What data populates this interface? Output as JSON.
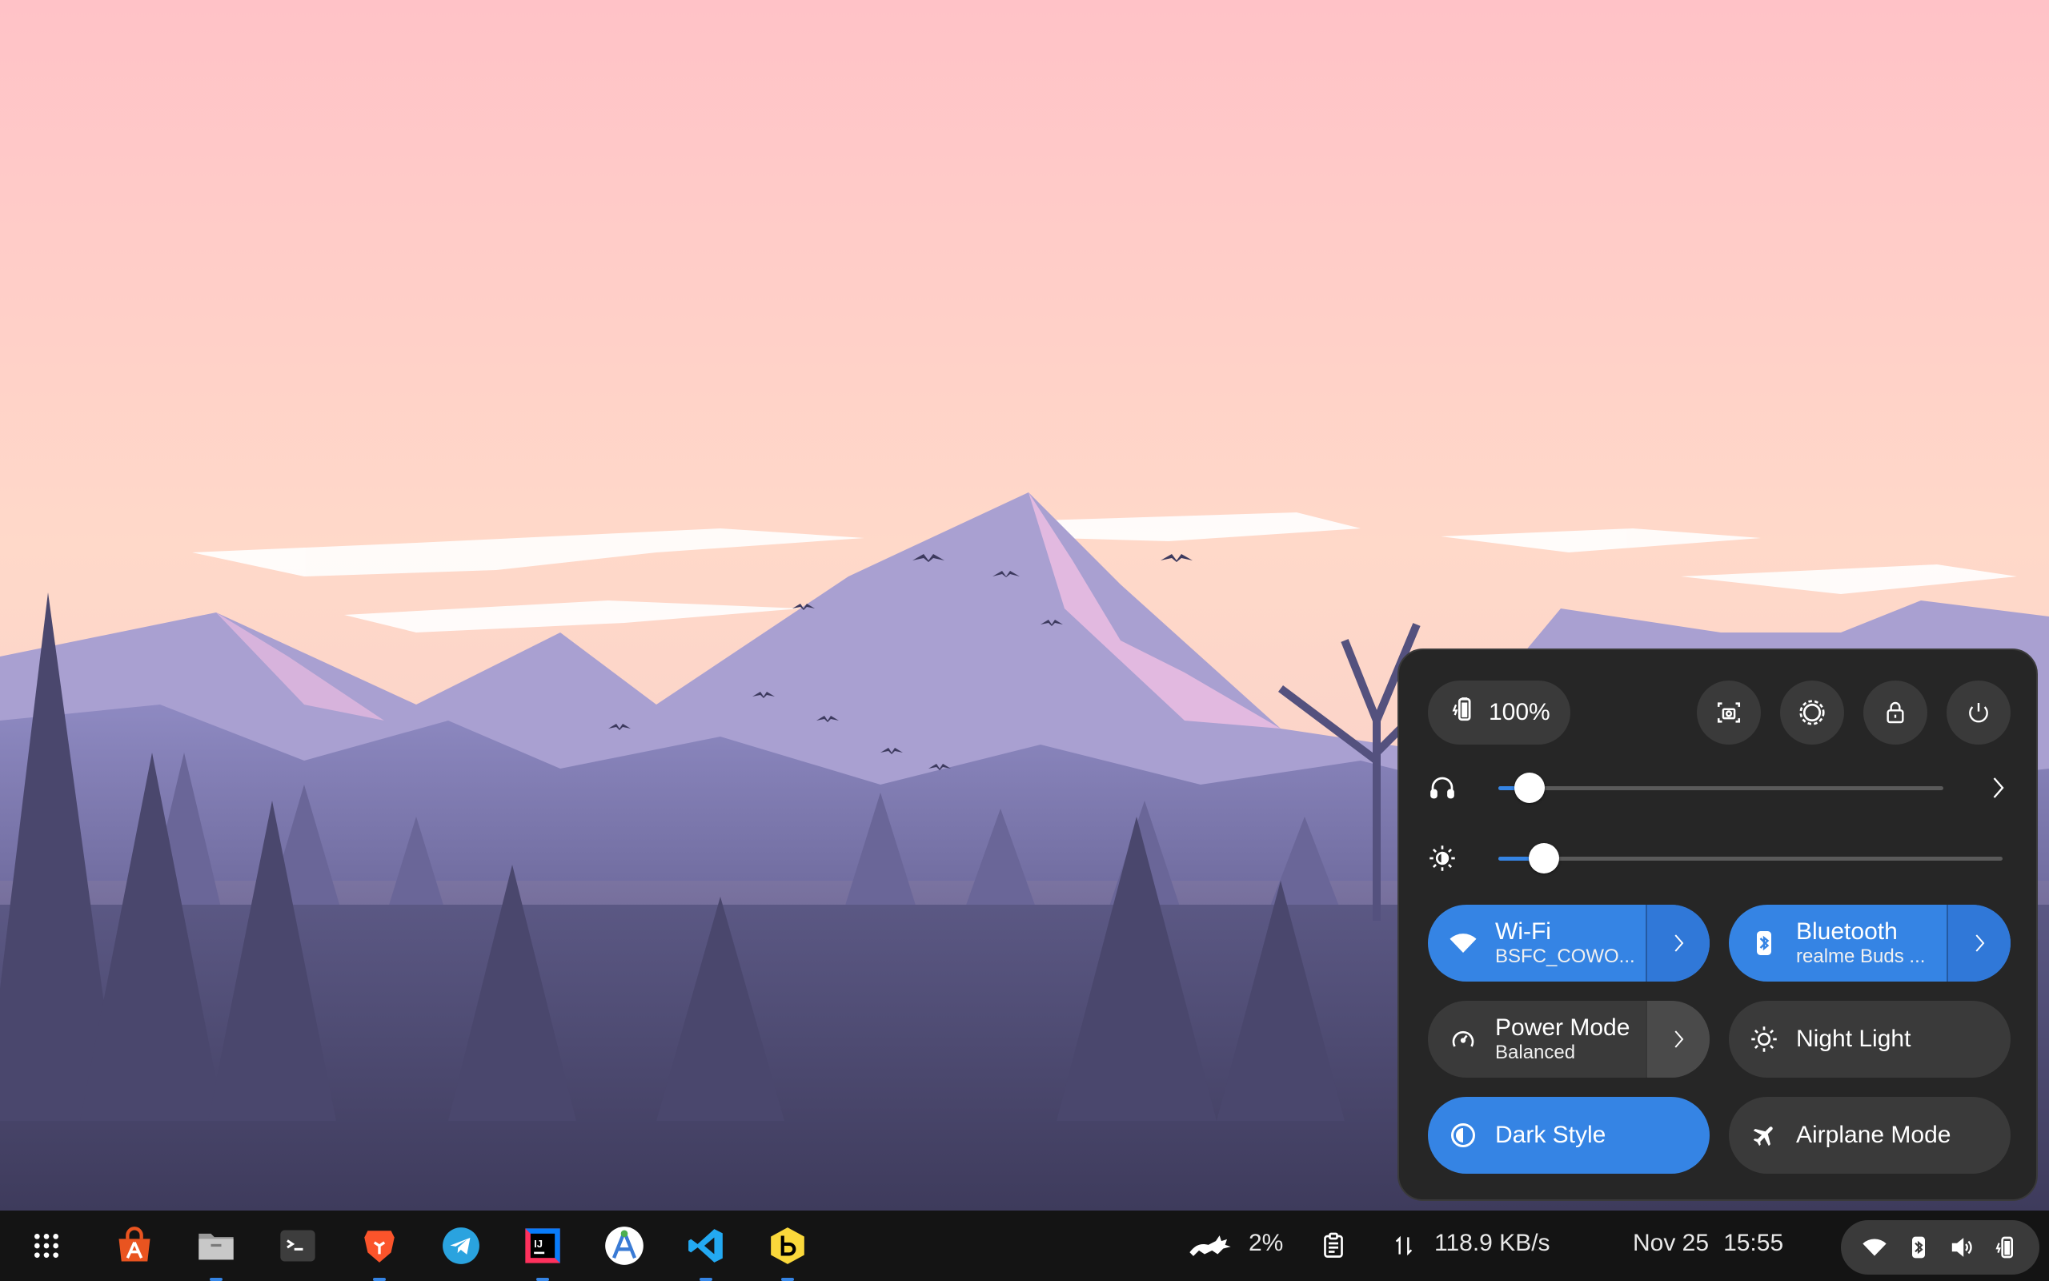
{
  "quick_settings": {
    "battery_level": "100%",
    "volume_value": 0.07,
    "brightness_value": 0.09,
    "wifi": {
      "title": "Wi-Fi",
      "subtitle": "BSFC_COWO..."
    },
    "bluetooth": {
      "title": "Bluetooth",
      "subtitle": "realme Buds ..."
    },
    "power_mode": {
      "title": "Power Mode",
      "subtitle": "Balanced"
    },
    "night_light": {
      "title": "Night Light"
    },
    "dark_style": {
      "title": "Dark Style"
    },
    "airplane_mode": {
      "title": "Airplane Mode"
    }
  },
  "taskbar": {
    "cpu": "2%",
    "net_speed": "118.9 KB/s",
    "date": "Nov 25",
    "time": "15:55",
    "apps": [
      "app-grid",
      "software-store",
      "files",
      "terminal",
      "brave",
      "telegram",
      "intellij-idea",
      "android-studio",
      "vscode",
      "beekeeper"
    ]
  },
  "colors": {
    "accent": "#3584e4",
    "panel_bg": "#262626",
    "tile_off": "#3a3a3a",
    "taskbar_bg": "#141414"
  }
}
